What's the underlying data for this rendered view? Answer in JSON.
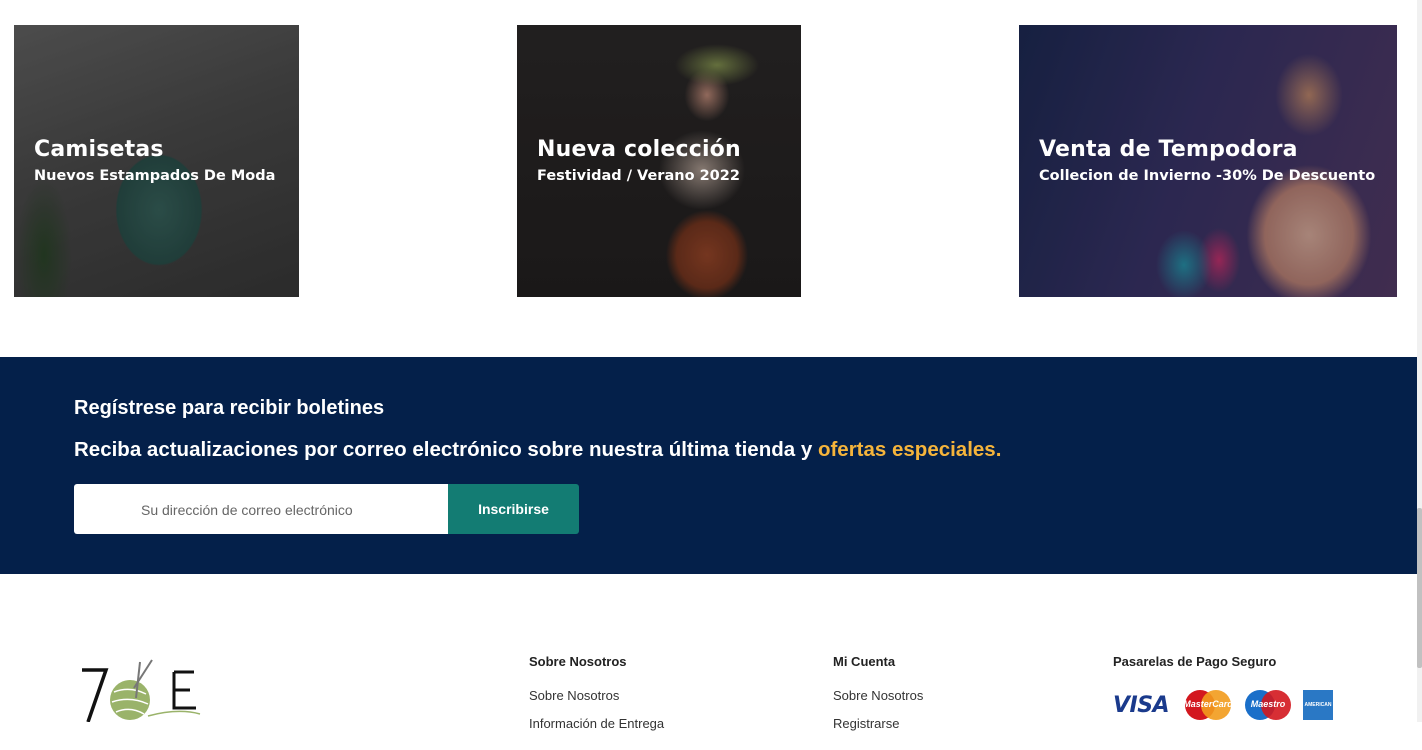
{
  "banners": [
    {
      "title": "Camisetas",
      "subtitle": "Nuevos Estampados De Moda"
    },
    {
      "title": "Nueva colección",
      "subtitle": "Festividad / Verano 2022"
    },
    {
      "title": "Venta de Tempodora",
      "subtitle": "Collecion de Invierno -30% De Descuento"
    }
  ],
  "newsletter": {
    "heading": "Regístrese para recibir boletines",
    "text": "Reciba actualizaciones por correo electrónico sobre nuestra última tienda y ",
    "highlight": "ofertas especiales.",
    "placeholder": "Su dirección de correo electrónico",
    "button": "Inscribirse",
    "bg_color": "#04204a",
    "button_color": "#137c73",
    "highlight_color": "#f5b43b"
  },
  "footer": {
    "logo_text": "7E",
    "col_nosotros": {
      "title": "Sobre Nosotros",
      "items": [
        "Sobre Nosotros",
        "Información de Entrega"
      ]
    },
    "col_cuenta": {
      "title": "Mi Cuenta",
      "items": [
        "Sobre Nosotros",
        "Registrarse"
      ]
    },
    "col_pagos": {
      "title": "Pasarelas de Pago Seguro",
      "cards": [
        "VISA",
        "MasterCard",
        "Maestro",
        "AMERICAN EXPRESS"
      ]
    }
  }
}
